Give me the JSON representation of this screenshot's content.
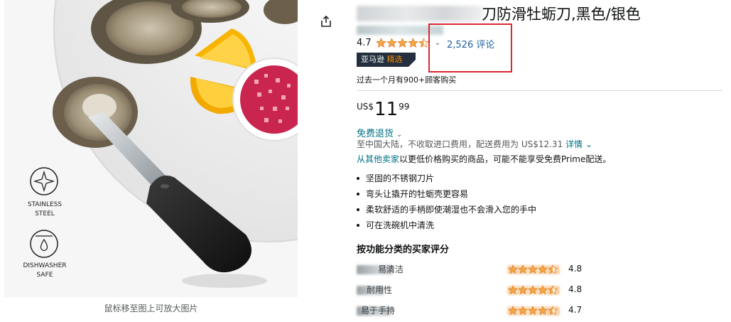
{
  "product": {
    "title_visible": "刀防滑牡蛎刀,黑色/银色",
    "rating": "4.7",
    "reviews_label": "2,526 评论",
    "badge_prefix": "亚马逊",
    "badge_accent": "精选",
    "bought_past_month": "过去一个月有900+顾客购买",
    "price": {
      "currency": "US$",
      "whole": "11",
      "fraction": "99"
    },
    "free_returns": "免费退货",
    "shipping_text": "至中国大陆，不收取进口费用，配送费用为 US$12.31",
    "shipping_details_link": "详情",
    "other_sellers_link": "从其他卖家",
    "other_sellers_text": "以更低价格购买的商品，可能不能享受免费Prime配送。",
    "bullets": [
      "坚固的不锈钢刀片",
      "弯头让撬开的牡蛎壳更容易",
      "柔软舒适的手柄即使潮湿也不会滑入您的手中",
      "可在洗碗机中清洗"
    ]
  },
  "image_panel": {
    "stainless_label_1": "STAINLESS",
    "stainless_label_2": "STEEL",
    "dishwasher_label_1": "DISHWASHER",
    "dishwasher_label_2": "SAFE",
    "hover_hint": "鼠标移至图上可放大图片"
  },
  "features": {
    "heading": "按功能分类的买家评分",
    "items": [
      {
        "label": "易清洁",
        "score": "4.8",
        "stars": 4.5
      },
      {
        "label": "耐用性",
        "score": "4.8",
        "stars": 4.5
      },
      {
        "label": "易于手持",
        "score": "4.7",
        "stars": 4.5
      }
    ]
  },
  "colors": {
    "star": "#f3a847",
    "link": "#007185",
    "highlight": "#e0262f",
    "badge_bg": "#232f3e",
    "badge_accent": "#f08804"
  },
  "icons": [
    "share-icon",
    "star-icon",
    "chevron-down-icon",
    "stainless-steel-icon",
    "dishwasher-safe-icon"
  ]
}
